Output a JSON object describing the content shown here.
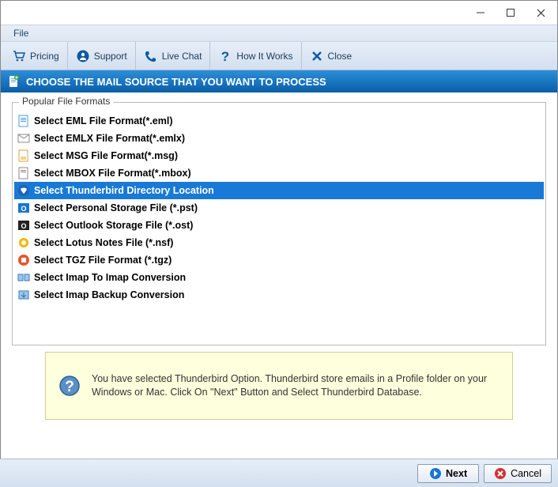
{
  "menubar": {
    "file": "File"
  },
  "toolbar": {
    "pricing": "Pricing",
    "support": "Support",
    "livechat": "Live Chat",
    "howitworks": "How It Works",
    "close": "Close"
  },
  "header": {
    "title": "CHOOSE THE MAIL SOURCE THAT YOU WANT TO PROCESS"
  },
  "fieldset": {
    "legend": "Popular File Formats"
  },
  "formats": {
    "eml": "Select EML File Format(*.eml)",
    "emlx": "Select EMLX File Format(*.emlx)",
    "msg": "Select MSG File Format(*.msg)",
    "mbox": "Select MBOX File Format(*.mbox)",
    "thunderbird": "Select Thunderbird Directory Location",
    "pst": "Select Personal Storage File (*.pst)",
    "ost": "Select Outlook Storage File (*.ost)",
    "nsf": "Select Lotus Notes File (*.nsf)",
    "tgz": "Select TGZ File Format (*.tgz)",
    "imap2imap": "Select Imap To Imap Conversion",
    "imapbackup": "Select Imap Backup Conversion"
  },
  "info": {
    "text": "You have selected Thunderbird Option. Thunderbird store emails in a Profile folder on your Windows or Mac. Click On \"Next\" Button and Select Thunderbird Database."
  },
  "footer": {
    "next": "Next",
    "cancel": "Cancel"
  }
}
